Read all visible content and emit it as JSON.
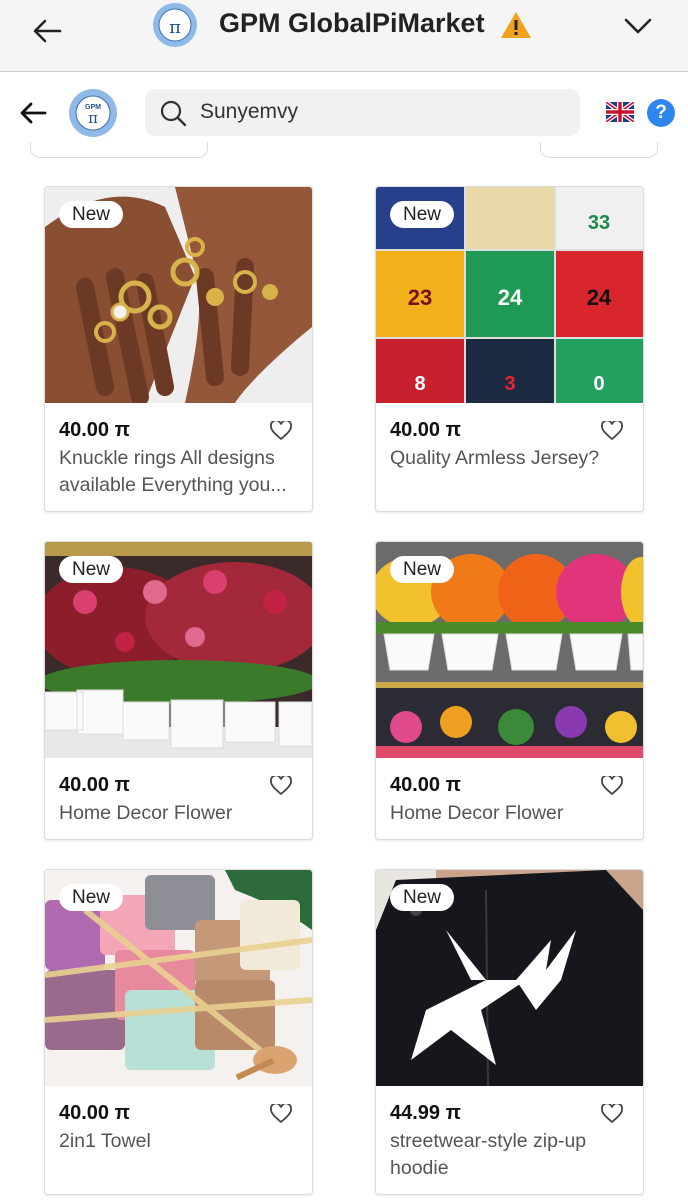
{
  "app": {
    "title": "GPM GlobalPiMarket",
    "accent": "#2f86f0",
    "warning_color": "#f0a21a"
  },
  "search": {
    "query": "Sunyemvy"
  },
  "products": [
    {
      "badge": "New",
      "price": "40.00 π",
      "name": "Knuckle rings All designs available Everything you...",
      "image": "gold-rings-on-hands"
    },
    {
      "badge": "New",
      "price": "40.00 π",
      "name": "Quality Armless Jersey?",
      "image": "basketball-jerseys-grid"
    },
    {
      "badge": "New",
      "price": "40.00 π",
      "name": "Home Decor Flower",
      "image": "red-pink-flower-pots"
    },
    {
      "badge": "New",
      "price": "40.00 π",
      "name": "Home Decor Flower",
      "image": "colorful-flower-pots"
    },
    {
      "badge": "New",
      "price": "40.00 π",
      "name": "2in1 Towel",
      "image": "folded-towels"
    },
    {
      "badge": "New",
      "price": "44.99 π",
      "name": "streetwear-style zip-up hoodie",
      "image": "black-star-hoodie"
    }
  ]
}
